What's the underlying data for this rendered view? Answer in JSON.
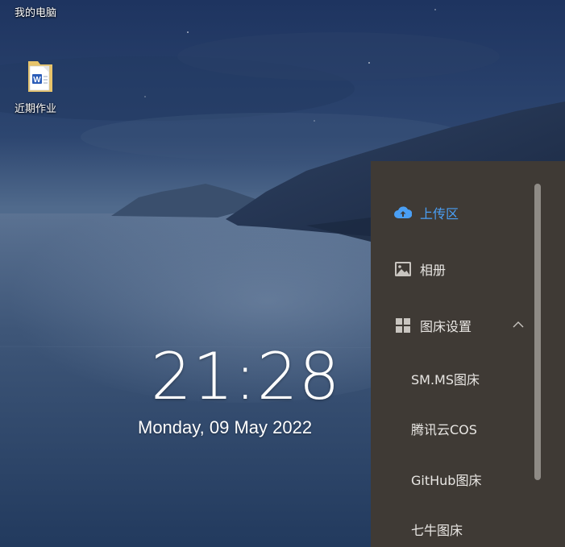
{
  "desktop": {
    "icons": [
      {
        "name": "this-pc",
        "label": "我的电脑"
      },
      {
        "name": "word-document",
        "label": "近期作业"
      }
    ]
  },
  "clock": {
    "time": "21:28",
    "date": "Monday, 09 May 2022"
  },
  "side_panel": {
    "items": [
      {
        "label": "上传区",
        "icon": "cloud-upload-icon",
        "active": true
      },
      {
        "label": "相册",
        "icon": "image-icon",
        "active": false
      },
      {
        "label": "图床设置",
        "icon": "grid-icon",
        "active": false,
        "expanded": true
      }
    ],
    "sub_items": [
      {
        "label": "SM.MS图床"
      },
      {
        "label": "腾讯云COS"
      },
      {
        "label": "GitHub图床"
      },
      {
        "label": "七牛图床"
      }
    ],
    "colors": {
      "background": "#3f3a35",
      "active": "#4a9ff5",
      "text": "#e8e6e3"
    }
  }
}
